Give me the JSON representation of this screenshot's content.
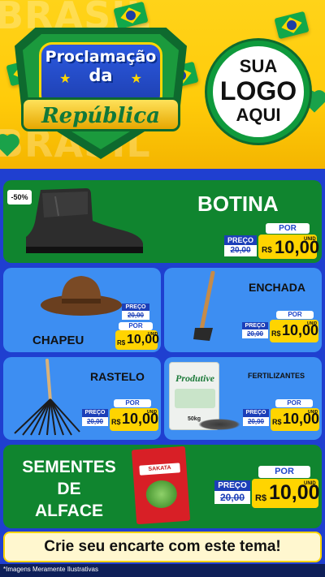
{
  "header": {
    "bg_word": "BRASIL",
    "title_line1": "Proclamação",
    "title_line2": "da",
    "title_line3": "República",
    "logo_line1": "SUA",
    "logo_line2": "LOGO",
    "logo_line3": "AQUI"
  },
  "labels": {
    "por": "POR",
    "preco": "PREÇO",
    "currency": "R$",
    "unid": "UNID",
    "old_price": "20,00"
  },
  "products": {
    "botina": {
      "name": "BOTINA",
      "discount": "-50%",
      "price": "10,00"
    },
    "chapeu": {
      "name": "CHAPEU",
      "price": "10,00"
    },
    "enchada": {
      "name": "ENCHADA",
      "price": "10,00"
    },
    "rastelo": {
      "name": "RASTELO",
      "price": "10,00"
    },
    "fertilizantes": {
      "name": "FERTILIZANTES",
      "bag_brand": "Produtive",
      "bag_weight": "50kg",
      "price": "10,00"
    },
    "sementes": {
      "name_line1": "SEMENTES",
      "name_line2": "DE",
      "name_line3": "ALFACE",
      "pack_brand": "SAKATA",
      "price": "10,00"
    }
  },
  "footer": {
    "cta": "Crie seu encarte com este tema!",
    "disclaimer": "*Imagens Meramente Ilustrativas"
  },
  "colors": {
    "green": "#10852f",
    "blue": "#3d8ef2",
    "yellow": "#ffd400",
    "navy": "#1c3fb8"
  }
}
